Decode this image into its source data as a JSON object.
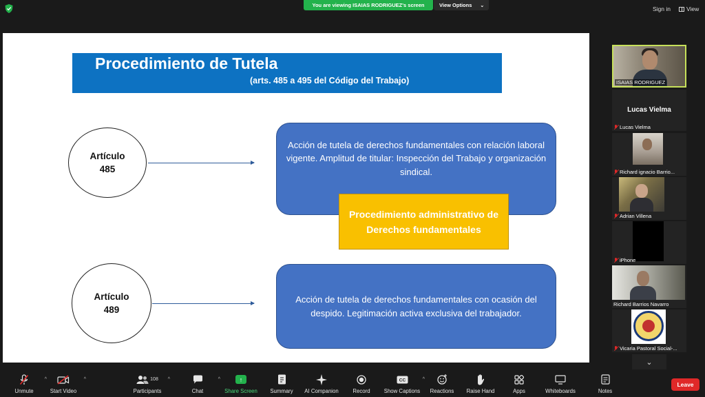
{
  "topbar": {
    "viewing_banner": "You are viewing ISAIAS RODRIGUEZ's screen",
    "view_options": "View Options",
    "sign_in": "Sign in",
    "view": "View"
  },
  "slide": {
    "title": "Procedimiento de Tutela",
    "subtitle": "(arts. 485 a 495 del Código del Trabajo)",
    "article1_label": "Artículo",
    "article1_number": "485",
    "article2_label": "Artículo",
    "article2_number": "489",
    "box1_text": "Acción de tutela de derechos fundamentales con relación laboral vigente. Amplitud de titular: Inspección del Trabajo y organización sindical.",
    "callout_text": "Procedimiento administrativo de Derechos fundamentales",
    "box2_text": "Acción de tutela de derechos fundamentales con ocasión del despido. Legitimación activa exclusiva del trabajador."
  },
  "participants": [
    {
      "name": "ISAIAS RODRIGUEZ",
      "muted": false
    },
    {
      "name": "Lucas Vielma",
      "display_name": "Lucas Vielma",
      "muted": true
    },
    {
      "name": "Richard ignacio Barrio...",
      "muted": true
    },
    {
      "name": "Adrian  Villena",
      "muted": true
    },
    {
      "name": "iPhone",
      "muted": true
    },
    {
      "name": "Richard Barrios Navarro",
      "muted": false
    },
    {
      "name": "Vicaria Pastoral Social-...",
      "muted": true
    }
  ],
  "toolbar": {
    "unmute": "Unmute",
    "start_video": "Start Video",
    "participants": "Participants",
    "participants_count": "108",
    "chat": "Chat",
    "share_screen": "Share Screen",
    "summary": "Summary",
    "ai_companion": "AI Companion",
    "record": "Record",
    "show_captions": "Show Captions",
    "reactions": "Reactions",
    "raise_hand": "Raise Hand",
    "apps": "Apps",
    "whiteboards": "Whiteboards",
    "notes": "Notes",
    "leave": "Leave"
  },
  "colors": {
    "banner_green": "#23b24c",
    "slide_blue": "#0d72c2",
    "box_blue": "#4472c4",
    "callout_yellow": "#f9c000",
    "leave_red": "#e02828",
    "active_speaker_border": "#c7e15a"
  }
}
